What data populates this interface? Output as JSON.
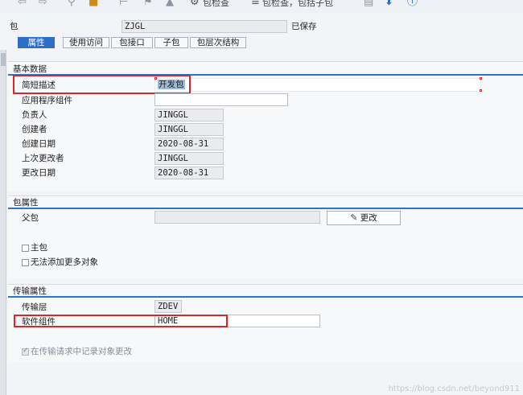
{
  "toolbar": {
    "package_check_label": "包检查",
    "package_check_sub_label": "包检查，包括子包"
  },
  "header": {
    "package_label": "包",
    "package_value": "ZJGL",
    "status": "已保存"
  },
  "tabs": [
    {
      "label": "属性",
      "active": true
    },
    {
      "label": "使用访问",
      "active": false
    },
    {
      "label": "包接口",
      "active": false
    },
    {
      "label": "子包",
      "active": false
    },
    {
      "label": "包层次结构",
      "active": false
    }
  ],
  "basic_data": {
    "title": "基本数据",
    "short_description_label": "简短描述",
    "short_description_value": "开发包",
    "app_component_label": "应用程序组件",
    "app_component_value": "",
    "responsible_label": "负责人",
    "responsible_value": "JINGGL",
    "creator_label": "创建者",
    "creator_value": "JINGGL",
    "created_on_label": "创建日期",
    "created_on_value": "2020-08-31",
    "last_changed_by_label": "上次更改者",
    "last_changed_by_value": "JINGGL",
    "changed_on_label": "更改日期",
    "changed_on_value": "2020-08-31"
  },
  "package_props": {
    "title": "包属性",
    "parent_label": "父包",
    "parent_value": "",
    "change_button": "更改",
    "main_package_label": "主包",
    "no_more_objects_label": "无法添加更多对象"
  },
  "transport_props": {
    "title": "传输属性",
    "transport_layer_label": "传输层",
    "transport_layer_value": "ZDEV",
    "software_component_label": "软件组件",
    "software_component_value": "HOME",
    "record_changes_label": "在传输请求中记录对象更改"
  },
  "watermark": "https://blog.csdn.net/beyond911",
  "colors": {
    "accent": "#2a78c5",
    "tab_active": "#2d6ec9",
    "highlight": "#d9262b"
  }
}
